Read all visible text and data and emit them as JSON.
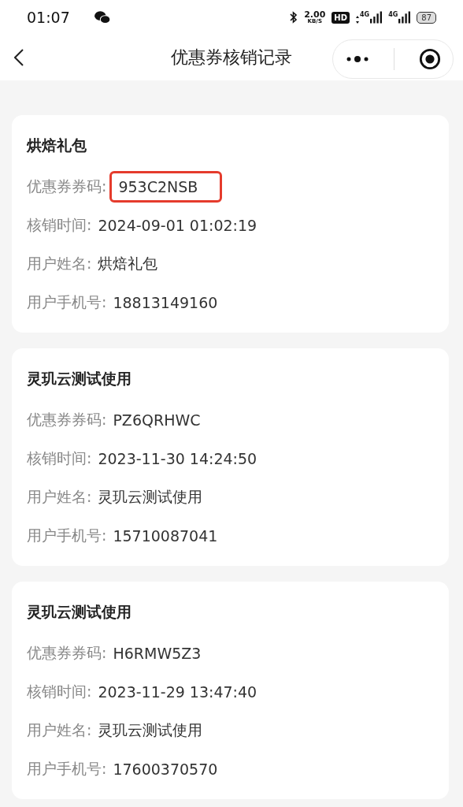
{
  "status_bar": {
    "time": "01:07",
    "net_speed": "2.00",
    "net_unit": "KB/S",
    "hd": "HD",
    "signals": [
      {
        "label": "4G",
        "arrows": true
      },
      {
        "label": "4G",
        "arrows": false
      }
    ],
    "battery": "87"
  },
  "nav": {
    "title": "优惠券核销记录"
  },
  "records": [
    {
      "title": "烘焙礼包",
      "fields": [
        {
          "label": "优惠券券码:",
          "value": "953C2NSB",
          "highlighted": true
        },
        {
          "label": "核销时间:",
          "value": "2024-09-01 01:02:19",
          "highlighted": false
        },
        {
          "label": "用户姓名:",
          "value": "烘焙礼包",
          "highlighted": false
        },
        {
          "label": "用户手机号:",
          "value": "18813149160",
          "highlighted": false
        }
      ]
    },
    {
      "title": "灵玑云测试使用",
      "fields": [
        {
          "label": "优惠券券码:",
          "value": "PZ6QRHWC",
          "highlighted": false
        },
        {
          "label": "核销时间:",
          "value": "2023-11-30 14:24:50",
          "highlighted": false
        },
        {
          "label": "用户姓名:",
          "value": "灵玑云测试使用",
          "highlighted": false
        },
        {
          "label": "用户手机号:",
          "value": "15710087041",
          "highlighted": false
        }
      ]
    },
    {
      "title": "灵玑云测试使用",
      "fields": [
        {
          "label": "优惠券券码:",
          "value": "H6RMW5Z3",
          "highlighted": false
        },
        {
          "label": "核销时间:",
          "value": "2023-11-29 13:47:40",
          "highlighted": false
        },
        {
          "label": "用户姓名:",
          "value": "灵玑云测试使用",
          "highlighted": false
        },
        {
          "label": "用户手机号:",
          "value": "17600370570",
          "highlighted": false
        }
      ]
    }
  ]
}
